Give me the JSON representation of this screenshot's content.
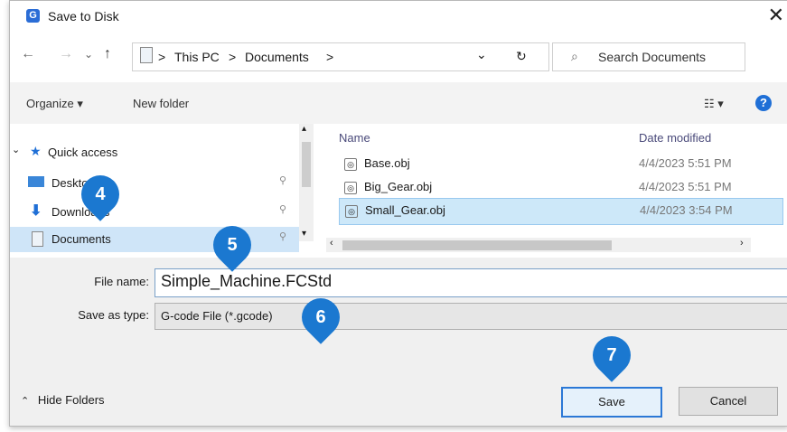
{
  "window": {
    "title": "Save to Disk",
    "app_icon": "app-icon",
    "close_glyph": "✕"
  },
  "nav": {
    "back": "←",
    "forward": "→",
    "recent": "⌄",
    "up": "↑",
    "breadcrumb": [
      "This PC",
      "Documents"
    ],
    "separator": ">",
    "dropdown": "⌄",
    "refresh": "↻",
    "search_placeholder": "Search Documents"
  },
  "toolbar": {
    "organize": "Organize ▾",
    "new_folder": "New folder",
    "view": "☷ ▾",
    "help": "?"
  },
  "sidebar": {
    "items": [
      {
        "label": "Quick access",
        "icon": "star-icon"
      },
      {
        "label": "Desktop",
        "icon": "desktop-icon"
      },
      {
        "label": "Downloads",
        "icon": "download-icon"
      },
      {
        "label": "Documents",
        "icon": "documents-icon"
      }
    ]
  },
  "file_list": {
    "columns": [
      "Name",
      "Date modified"
    ],
    "rows": [
      {
        "name": "Base.obj",
        "date": "4/4/2023 5:51 PM"
      },
      {
        "name": "Big_Gear.obj",
        "date": "4/4/2023 5:51 PM"
      },
      {
        "name": "Small_Gear.obj",
        "date": "4/4/2023 3:54 PM"
      }
    ]
  },
  "form": {
    "file_name_label": "File name:",
    "file_name_value": "Simple_Machine.FCStd",
    "save_type_label": "Save as type:",
    "save_type_value": "G-code File (*.gcode)"
  },
  "footer": {
    "hide_folders": "Hide Folders",
    "save": "Save",
    "cancel": "Cancel"
  },
  "callouts": [
    "4",
    "5",
    "6",
    "7"
  ],
  "colors": {
    "accent": "#1b78d0",
    "selection": "#cde8f9"
  }
}
